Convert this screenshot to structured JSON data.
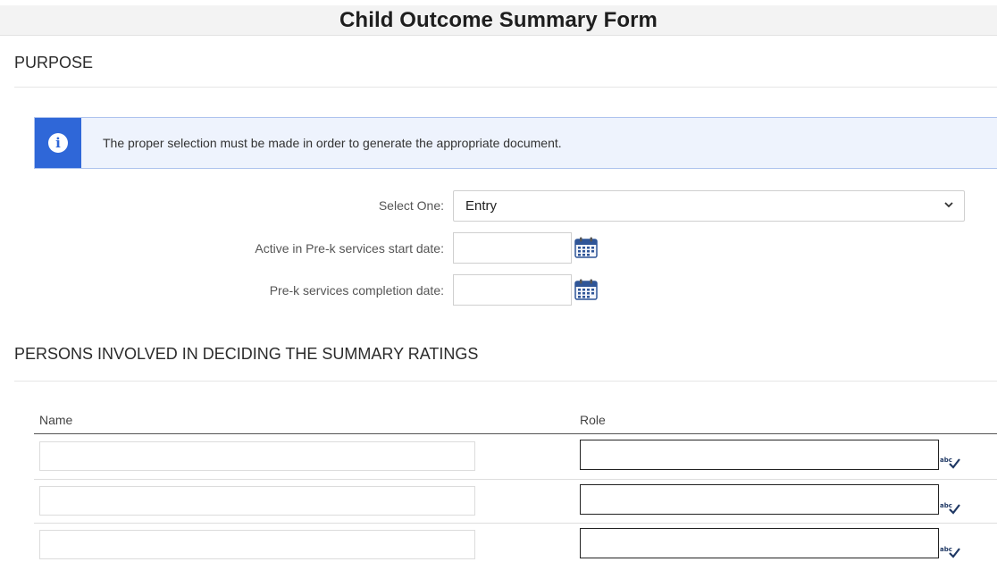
{
  "form": {
    "title": "Child Outcome Summary Form"
  },
  "purpose": {
    "heading": "PURPOSE",
    "info_message": "The proper selection must be made in order to generate the appropriate document.",
    "select_label": "Select One:",
    "select_value": "Entry",
    "start_date_label": "Active in Pre-k services start date:",
    "start_date_value": "",
    "completion_date_label": "Pre-k services completion date:",
    "completion_date_value": ""
  },
  "persons": {
    "heading": "PERSONS INVOLVED IN DECIDING THE SUMMARY RATINGS",
    "columns": {
      "name": "Name",
      "role": "Role"
    },
    "rows": [
      {
        "name": "",
        "role": ""
      },
      {
        "name": "",
        "role": ""
      },
      {
        "name": "",
        "role": ""
      }
    ]
  },
  "icons": {
    "info": "info-icon",
    "calendar": "calendar-icon",
    "spellcheck": "spellcheck-icon",
    "chevron": "chevron-down-icon"
  },
  "colors": {
    "info_accent": "#2f67d8",
    "info_background": "#eef3fd",
    "calendar_blue": "#2f5597"
  }
}
